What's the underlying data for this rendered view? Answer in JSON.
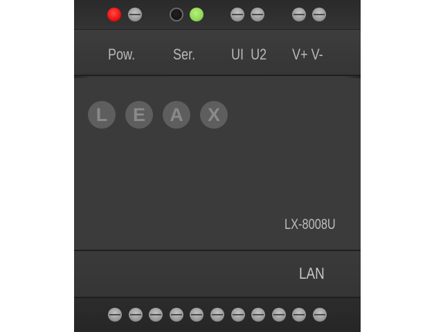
{
  "device": {
    "top_indicators": [
      {
        "name": "power-led",
        "state": "on",
        "color": "#ee1111"
      },
      {
        "name": "power-terminal",
        "state": "screw"
      },
      {
        "name": "serial-led-left",
        "state": "off"
      },
      {
        "name": "serial-led-right",
        "state": "on",
        "color": "#8fd855"
      },
      {
        "name": "u1-terminal",
        "state": "screw"
      },
      {
        "name": "u2-terminal",
        "state": "screw"
      },
      {
        "name": "vplus-terminal",
        "state": "screw"
      },
      {
        "name": "vminus-terminal",
        "state": "screw"
      }
    ],
    "labels": {
      "power": "Pow.",
      "serial": "Ser.",
      "u1u2": "UI  U2",
      "voltage": "V+ V-"
    },
    "logo_letters": [
      "L",
      "E",
      "A",
      "X"
    ],
    "model": "LX-8008U",
    "port_label": "LAN",
    "bottom_terminal_count": 11,
    "colors": {
      "body": "#3b3b3b",
      "text": "#bdbdbd",
      "logo_circle": "#5e5e5e",
      "logo_text": "#8a8a8a"
    }
  }
}
